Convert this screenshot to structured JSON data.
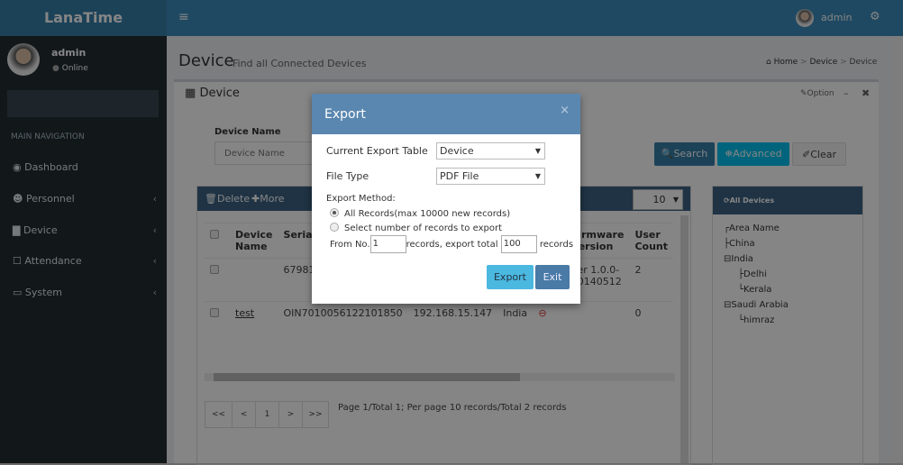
{
  "app": {
    "logo": "LanaTime",
    "user": "admin"
  },
  "sidebar": {
    "user": "admin",
    "status": "Online",
    "section": "MAIN NAVIGATION",
    "items": [
      {
        "label": "Dashboard",
        "icon": "dashboard-icon"
      },
      {
        "label": "Personnel",
        "icon": "users-icon"
      },
      {
        "label": "Device",
        "icon": "building-icon"
      },
      {
        "label": "Attendance",
        "icon": "calendar-icon"
      },
      {
        "label": "System",
        "icon": "laptop-icon"
      }
    ]
  },
  "page": {
    "title": "Device",
    "subtitle": "Find all Connected Devices",
    "breadcrumb": [
      "Home",
      "Device",
      "Device"
    ]
  },
  "panel": {
    "title": "Device",
    "option": "Option",
    "filter_label": "Device Name",
    "filter_placeholder": "Device Name",
    "search": "Search",
    "advanced": "Advanced",
    "clear": "Clear",
    "delete": "Delete",
    "more": "More",
    "page_size": "10"
  },
  "table": {
    "headers": [
      "Device Name",
      "Serial Nu",
      "",
      "",
      "",
      "",
      "Firmware Version",
      "User Count"
    ],
    "rows": [
      {
        "name": "",
        "serial": "67981720",
        "ip": "",
        "area": "",
        "firmware": "Ver 1.0.0-20140512",
        "users": "2"
      },
      {
        "name": "test",
        "serial": "OIN7010056122101850",
        "ip": "192.168.15.147",
        "area": "India",
        "firmware": "",
        "users": "0"
      }
    ]
  },
  "pagination": {
    "first": "<<",
    "prev": "<",
    "current": "1",
    "next": ">",
    "last": ">>",
    "info": "Page 1/Total 1; Per page 10 records/Total 2 records"
  },
  "tree": {
    "title": "All Devices",
    "nodes": [
      "Area Name",
      "China",
      "India",
      "Delhi",
      "Kerala",
      "Saudi Arabia",
      "himraz"
    ]
  },
  "modal": {
    "title": "Export",
    "close": "×",
    "table_label": "Current Export Table",
    "table_value": "Device",
    "type_label": "File Type",
    "type_value": "PDF File",
    "method_label": "Export Method:",
    "opt_all": "All Records(max 10000 new records)",
    "opt_select": "Select number of records to export",
    "from_label": "From No.",
    "from_value": "1",
    "mid_label": "records, export total",
    "total_value": "100",
    "end_label": "records",
    "export": "Export",
    "exit": "Exit",
    "selected_option": "all"
  },
  "colors": {
    "header": "#3c8dbc",
    "modal_header": "#5a87b0",
    "export_btn": "#4bb8e0",
    "exit_btn": "#4a7aa6",
    "sidebar": "#222d32"
  }
}
